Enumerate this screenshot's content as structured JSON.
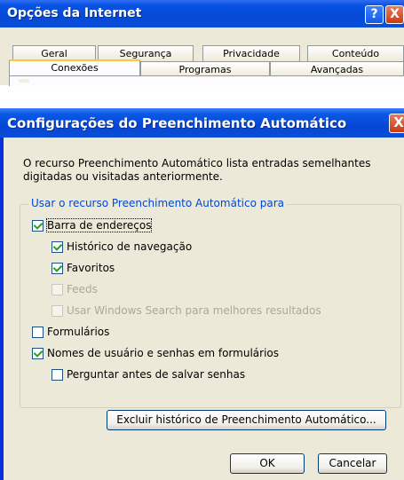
{
  "window1": {
    "title": "Opções da Internet",
    "help_glyph": "?",
    "close_glyph": "X",
    "tabs_row1": [
      "Geral",
      "Segurança",
      "Privacidade",
      "Conteúdo"
    ],
    "tabs_row2": [
      "Conexões",
      "Programas",
      "Avançadas"
    ],
    "active_tab": "Conexões"
  },
  "dialog": {
    "title": "Configurações do Preenchimento Automático",
    "close_glyph": "X",
    "description_line1": "O recurso Preenchimento Automático lista entradas semelhantes",
    "description_line2": "digitadas ou visitadas anteriormente.",
    "group_label": "Usar o recurso Preenchimento Automático para",
    "options": {
      "address_bar": {
        "label": "Barra de endereços",
        "checked": true
      },
      "history": {
        "label": "Histórico de navegação",
        "checked": true
      },
      "favorites": {
        "label": "Favoritos",
        "checked": true
      },
      "feeds": {
        "label": "Feeds",
        "checked": false,
        "disabled": true
      },
      "windows_search": {
        "label": "Usar Windows Search para melhores resultados",
        "checked": false,
        "disabled": true
      },
      "forms": {
        "label": "Formulários",
        "checked": false
      },
      "usernames": {
        "label": "Nomes de usuário e senhas em formulários",
        "checked": true
      },
      "ask_save": {
        "label": "Perguntar antes de salvar senhas",
        "checked": false
      }
    },
    "delete_history_button": "Excluir histórico de Preenchimento Automático...",
    "ok_button": "OK",
    "cancel_button": "Cancelar"
  },
  "colors": {
    "titlebar_blue": "#0548d6",
    "dialog_face": "#ece9d8",
    "group_label_blue": "#0046d5",
    "checkmark_green": "#21a121",
    "close_red": "#c63c17"
  }
}
